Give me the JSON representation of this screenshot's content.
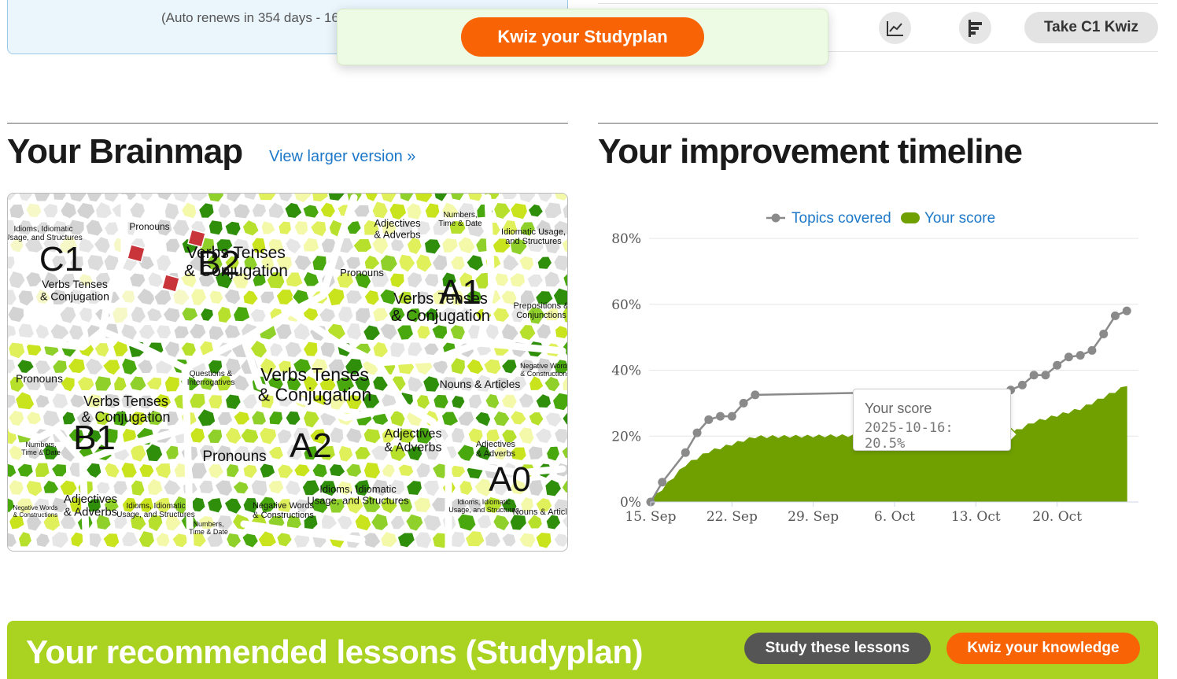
{
  "subscription": {
    "renew_text": "(Auto renews in 354 days - 16"
  },
  "toolbar": {
    "chart_icon": "line-chart-icon",
    "bars_icon": "horizontal-bars-icon",
    "take_label": "Take C1 Kwiz"
  },
  "floating": {
    "kwiz_label": "Kwiz your Studyplan"
  },
  "brainmap": {
    "title": "Your Brainmap",
    "link": "View larger version »",
    "levels": [
      "C1",
      "B2",
      "A1",
      "B1",
      "A2",
      "A0"
    ],
    "regions": [
      {
        "label": "Idioms, Idiomatic Usage, and Structures"
      },
      {
        "label": "Pronouns"
      },
      {
        "label": "Verbs Tenses & Conjugation"
      },
      {
        "label": "Adjectives & Adverbs"
      },
      {
        "label": "Numbers, Time & Date"
      },
      {
        "label": "Idiomatic Usage, and Structures"
      },
      {
        "label": "Prepositions & Conjunctions"
      },
      {
        "label": "Questions & Interrogatives"
      },
      {
        "label": "Nouns & Articles"
      },
      {
        "label": "Negative Words & Constructions"
      }
    ]
  },
  "timeline": {
    "title": "Your improvement timeline",
    "tooltip_title": "Your score",
    "tooltip_value": "2025-10-16: 20.5%"
  },
  "chart_data": {
    "type": "area",
    "title": "",
    "legend_position": "top-center",
    "x_ticks": [
      "15. Sep",
      "22. Sep",
      "29. Sep",
      "6. Oct",
      "13. Oct",
      "20. Oct"
    ],
    "y_ticks": [
      "0%",
      "20%",
      "40%",
      "60%",
      "80%"
    ],
    "ylim": [
      0,
      80
    ],
    "series": [
      {
        "name": "Topics covered",
        "type": "line",
        "color": "#8a8a8a",
        "points": [
          [
            "2025-09-15",
            0
          ],
          [
            "2025-09-16",
            6
          ],
          [
            "2025-09-18",
            15
          ],
          [
            "2025-09-19",
            21
          ],
          [
            "2025-09-20",
            25
          ],
          [
            "2025-09-21",
            26
          ],
          [
            "2025-09-22",
            26
          ],
          [
            "2025-09-23",
            30
          ],
          [
            "2025-09-24",
            32.5
          ],
          [
            "2025-10-16",
            34
          ],
          [
            "2025-10-17",
            35.5
          ],
          [
            "2025-10-18",
            38.5
          ],
          [
            "2025-10-19",
            38.5
          ],
          [
            "2025-10-20",
            41.5
          ],
          [
            "2025-10-21",
            44
          ],
          [
            "2025-10-22",
            44.5
          ],
          [
            "2025-10-23",
            46
          ],
          [
            "2025-10-24",
            51
          ],
          [
            "2025-10-25",
            56.5
          ],
          [
            "2025-10-26",
            58
          ]
        ]
      },
      {
        "name": "Your score",
        "type": "area",
        "color": "#6fa000",
        "points": [
          [
            "2025-09-15",
            0
          ],
          [
            "2025-09-18",
            11
          ],
          [
            "2025-09-20",
            15
          ],
          [
            "2025-09-24",
            19.5
          ],
          [
            "2025-10-16",
            20.5
          ],
          [
            "2025-10-18",
            24
          ],
          [
            "2025-10-22",
            28
          ],
          [
            "2025-10-26",
            35
          ]
        ]
      }
    ]
  },
  "studyplan": {
    "title": "Your recommended lessons (Studyplan)",
    "study_label": "Study these lessons",
    "kwiz_label": "Kwiz your knowledge"
  }
}
